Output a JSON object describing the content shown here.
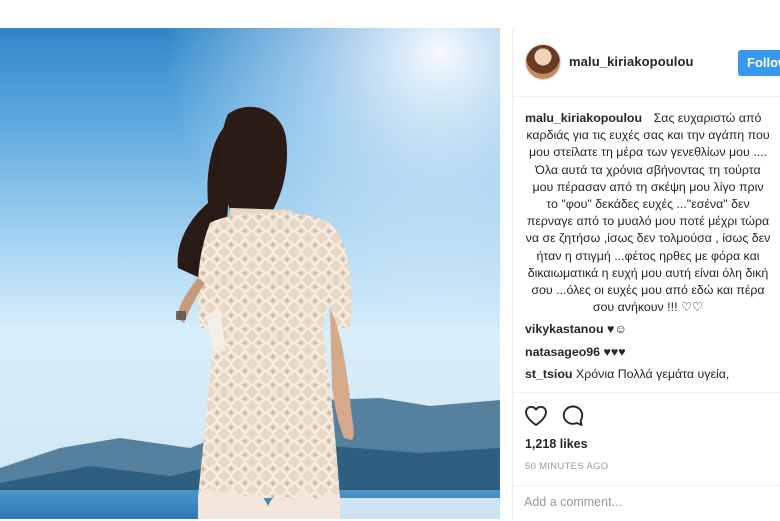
{
  "post": {
    "username": "malu_kiriakopoulou",
    "follow_label": "Follow",
    "caption_author": "malu_kiriakopoulou",
    "caption_text": "Σας ευχαριστώ από καρδιάς για τις ευχές σας και την αγάπη που μου στείλατε τη μέρα των γενεθλίων μου .... Όλα αυτά τα χρόνια σβήνοντας τη τούρτα μου πέρασαν από τη σκέψη μου λίγο πριν το \"φου\" δεκάδες ευχές ...\"εσένα\" δεν περναγε από το μυαλό μου ποτέ μέχρι τώρα να σε ζητήσω ,ίσως δεν τολμούσα , ίσως δεν ήταν η στιγμή ...φέτος ηρθες με φόρα και δικαιωματικά η ευχή μου αυτή είναι όλη δική σου ...όλες οι ευχές μου από εδώ και πέρα σου ανήκουν !!! ♡♡",
    "comments": [
      {
        "author": "vikykastanou",
        "text": "♥☺"
      },
      {
        "author": "natasageo96",
        "text": "♥♥♥"
      },
      {
        "author": "st_tsiou",
        "text": "Χρόνια Πολλά γεμάτα υγεία,"
      }
    ],
    "likes": "1,218 likes",
    "time": "50 MINUTES AGO",
    "add_comment_placeholder": "Add a comment..."
  },
  "icons": {
    "like": "heart-outline-icon",
    "comment": "speech-bubble-icon"
  },
  "colors": {
    "follow_bg": "#3897f0",
    "text": "#262626",
    "muted": "#999999"
  }
}
